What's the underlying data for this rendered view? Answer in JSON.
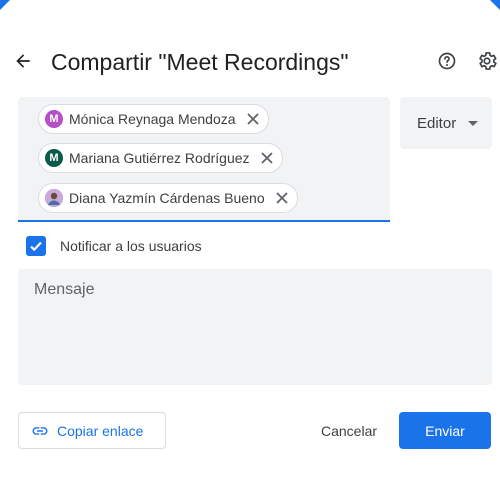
{
  "header": {
    "title": "Compartir \"Meet Recordings\""
  },
  "recipients": [
    {
      "initial": "M",
      "name": "Mónica Reynaga Mendoza",
      "avatar_color": "#b64ec9"
    },
    {
      "initial": "M",
      "name": "Mariana Gutiérrez Rodríguez",
      "avatar_color": "#0b5a4a"
    },
    {
      "initial": "",
      "name": "Diana Yazmín Cárdenas Bueno",
      "avatar_color": "#8a6a9c"
    }
  ],
  "role": {
    "selected": "Editor"
  },
  "notify": {
    "label": "Notificar a los usuarios",
    "checked": true
  },
  "message": {
    "placeholder": "Mensaje"
  },
  "footer": {
    "copy_link_label": "Copiar enlace",
    "cancel_label": "Cancelar",
    "send_label": "Enviar"
  },
  "colors": {
    "accent": "#1a73e8",
    "field_bg": "#f1f3f4"
  }
}
